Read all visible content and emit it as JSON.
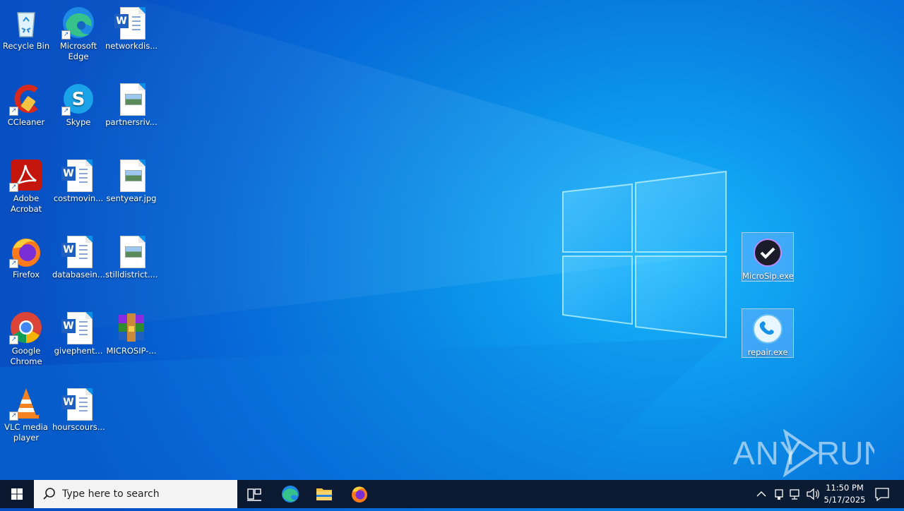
{
  "desktop": {
    "icons": [
      {
        "label": "Recycle Bin"
      },
      {
        "label": "Microsoft Edge"
      },
      {
        "label": "networkdis..."
      },
      {
        "label": "CCleaner"
      },
      {
        "label": "Skype"
      },
      {
        "label": "partnersriv..."
      },
      {
        "label": "Adobe Acrobat"
      },
      {
        "label": "costmovin..."
      },
      {
        "label": "sentyear.jpg"
      },
      {
        "label": "Firefox"
      },
      {
        "label": "databasein..."
      },
      {
        "label": "stilldistrict...."
      },
      {
        "label": "Google Chrome"
      },
      {
        "label": "givephent..."
      },
      {
        "label": "MICROSIP-..."
      },
      {
        "label": "VLC media player"
      },
      {
        "label": "hourscours..."
      },
      {
        "label": "MicroSip.exe"
      },
      {
        "label": "repair.exe"
      }
    ],
    "watermark": "ANY RUN"
  },
  "taskbar": {
    "search_placeholder": "Type here to search",
    "time": "11:50 PM",
    "date": "5/17/2025"
  }
}
